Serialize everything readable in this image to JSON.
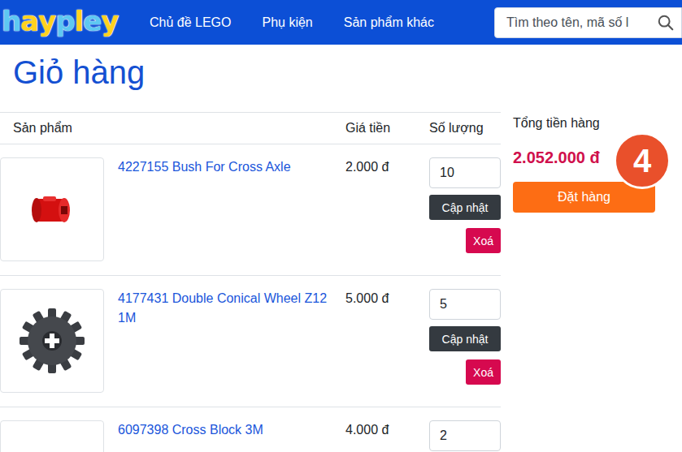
{
  "header": {
    "logo": [
      {
        "char": "h",
        "color": "#5ec8f2"
      },
      {
        "char": "a",
        "color": "#ffd21f"
      },
      {
        "char": "y",
        "color": "#ffd21f"
      },
      {
        "char": "p",
        "color": "#5ec8f2"
      },
      {
        "char": "l",
        "color": "#ffd21f"
      },
      {
        "char": "e",
        "color": "#5ec8f2"
      },
      {
        "char": "y",
        "color": "#ffd21f"
      }
    ],
    "nav": [
      "Chủ đề LEGO",
      "Phụ kiện",
      "Sản phẩm khác"
    ],
    "search": {
      "placeholder": "Tìm theo tên, mã số l"
    }
  },
  "page_title": "Giỏ hàng",
  "table": {
    "columns": [
      "Sản phẩm",
      "Giá tiền",
      "Số lượng"
    ],
    "actions": {
      "update": "Cập nhật",
      "delete": "Xoá"
    },
    "rows": [
      {
        "kind": "bush",
        "name": "4227155 Bush For Cross Axle",
        "price": "2.000 đ",
        "quantity": "10"
      },
      {
        "kind": "gear",
        "name": "4177431 Double Conical Wheel Z12 1M",
        "price": "5.000 đ",
        "quantity": "5"
      },
      {
        "kind": "block",
        "name": "6097398 Cross Block 3M",
        "price": "4.000 đ",
        "quantity": "2"
      }
    ]
  },
  "summary": {
    "label": "Tổng tiền hàng",
    "total": "2.052.000 đ",
    "order_button": "Đặt hàng"
  },
  "badge": "4"
}
